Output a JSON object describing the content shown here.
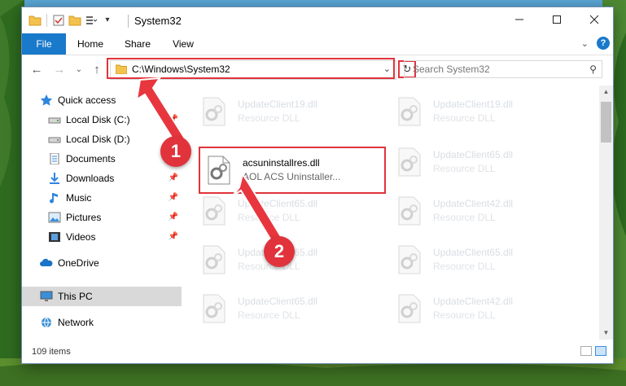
{
  "window": {
    "title": "System32",
    "controls": [
      "minimize-icon",
      "maximize-icon",
      "close-icon"
    ]
  },
  "ribbon": {
    "tabs": [
      {
        "label": "File"
      },
      {
        "label": "Home"
      },
      {
        "label": "Share"
      },
      {
        "label": "View"
      }
    ]
  },
  "address_bar": {
    "path": "C:\\Windows\\System32",
    "search_placeholder": "Search System32"
  },
  "nav_pane": {
    "items": [
      {
        "label": "Quick access",
        "icon": "star-icon"
      },
      {
        "label": "Local Disk (C:)",
        "icon": "drive-icon"
      },
      {
        "label": "Local Disk (D:)",
        "icon": "drive-icon"
      },
      {
        "label": "Documents",
        "icon": "documents-icon"
      },
      {
        "label": "Downloads",
        "icon": "download-icon"
      },
      {
        "label": "Music",
        "icon": "music-icon"
      },
      {
        "label": "Pictures",
        "icon": "pictures-icon"
      },
      {
        "label": "Videos",
        "icon": "videos-icon"
      },
      {
        "label": "OneDrive",
        "icon": "cloud-icon"
      },
      {
        "label": "This PC",
        "icon": "computer-icon"
      },
      {
        "label": "Network",
        "icon": "network-icon"
      }
    ]
  },
  "files": {
    "left_column": [
      {
        "name": "UpdateClient19.dll",
        "desc": "Resource DLL"
      },
      {
        "name": "acsuninstallres.dll",
        "desc": "AOL ACS Uninstaller..."
      },
      {
        "name": "UpdateClient65.dll",
        "desc": "Resource DLL"
      },
      {
        "name": "UpdateClient65.dll",
        "desc": "Resource DLL"
      },
      {
        "name": "UpdateClient65.dll",
        "desc": "Resource DLL"
      }
    ],
    "right_column": [
      {
        "name": "UpdateClient19.dll",
        "desc": "Resource DLL"
      },
      {
        "name": "UpdateClient65.dll",
        "desc": "Resource DLL"
      },
      {
        "name": "UpdateClient42.dll",
        "desc": "Resource DLL"
      },
      {
        "name": "UpdateClient65.dll",
        "desc": "Resource DLL"
      },
      {
        "name": "UpdateClient42.dll",
        "desc": "Resource DLL"
      }
    ]
  },
  "status_bar": {
    "item_count": "109 items"
  },
  "annotations": {
    "step1": "1",
    "step2": "2",
    "color": "#e0333b"
  }
}
